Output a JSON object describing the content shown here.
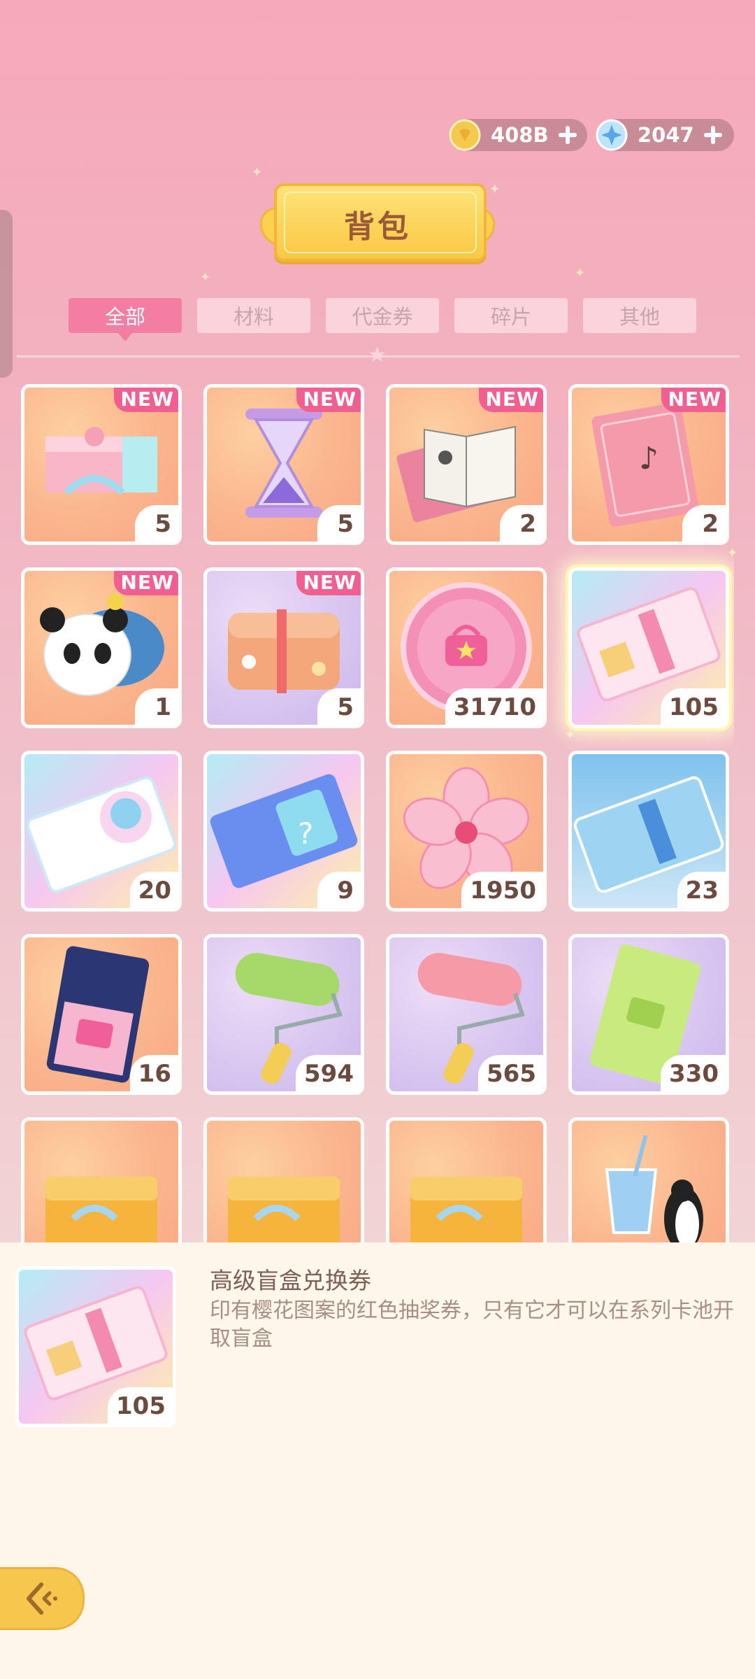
{
  "currency": [
    {
      "icon": "gold-coin-icon",
      "value": "408B"
    },
    {
      "icon": "blue-gem-icon",
      "value": "2047"
    }
  ],
  "title": "背包",
  "tabs": [
    {
      "label": "全部",
      "active": true
    },
    {
      "label": "材料",
      "active": false
    },
    {
      "label": "代金券",
      "active": false
    },
    {
      "label": "碎片",
      "active": false
    },
    {
      "label": "其他",
      "active": false
    }
  ],
  "items": [
    {
      "icon": "gift-box-icon",
      "count": "5",
      "new": "NEW"
    },
    {
      "icon": "hourglass-icon",
      "count": "5",
      "new": "NEW"
    },
    {
      "icon": "sketchbook-icon",
      "count": "2",
      "new": "NEW"
    },
    {
      "icon": "music-book-icon",
      "count": "2",
      "new": "NEW"
    },
    {
      "icon": "panda-plush-icon",
      "count": "1",
      "new": "NEW"
    },
    {
      "icon": "bento-box-icon",
      "count": "5",
      "new": "NEW"
    },
    {
      "icon": "pink-bag-token-icon",
      "count": "31710",
      "new": ""
    },
    {
      "icon": "rainbow-ticket-icon",
      "count": "105",
      "new": ""
    },
    {
      "icon": "avatar-ticket-icon",
      "count": "20",
      "new": ""
    },
    {
      "icon": "mystery-ticket-icon",
      "count": "9",
      "new": ""
    },
    {
      "icon": "sakura-flower-icon",
      "count": "1950",
      "new": ""
    },
    {
      "icon": "blue-ticket-icon",
      "count": "23",
      "new": ""
    },
    {
      "icon": "navy-ticket-icon",
      "count": "16",
      "new": ""
    },
    {
      "icon": "green-paint-roller-icon",
      "count": "594",
      "new": ""
    },
    {
      "icon": "pink-paint-roller-icon",
      "count": "565",
      "new": ""
    },
    {
      "icon": "green-ticket-icon",
      "count": "330",
      "new": ""
    },
    {
      "icon": "orange-gift-box-icon",
      "count": "",
      "new": ""
    },
    {
      "icon": "orange-gift-box-icon",
      "count": "",
      "new": ""
    },
    {
      "icon": "orange-gift-box-icon",
      "count": "",
      "new": ""
    },
    {
      "icon": "penguin-drink-icon",
      "count": "",
      "new": ""
    }
  ],
  "detail": {
    "icon": "rainbow-ticket-icon",
    "count": "105",
    "name": "高级盲盒兑换券",
    "description": "印有樱花图案的红色抽奖券，只有它才可以在系列卡池开取盲盒"
  },
  "back_icon": "back-arrow-icon"
}
